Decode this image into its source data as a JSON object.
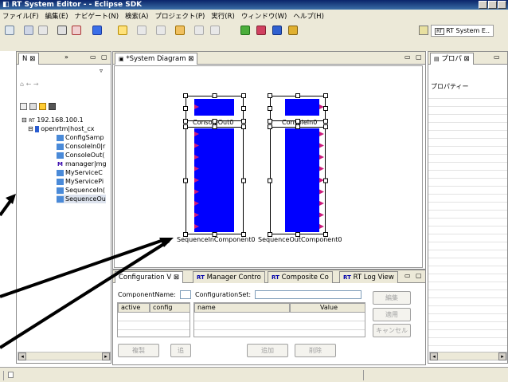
{
  "window": {
    "title": "RT System Editor - - Eclipse SDK"
  },
  "menu": [
    "ファイル(F)",
    "編集(E)",
    "ナビゲート(N)",
    "検索(A)",
    "プロジェクト(P)",
    "実行(R)",
    "ウィンドウ(W)",
    "ヘルプ(H)"
  ],
  "toolbar": {
    "perspective_label": "RT System E.."
  },
  "navigator": {
    "tab_label": "N",
    "nav_arrows": [
      "←",
      "→"
    ],
    "tree": [
      {
        "label": "192.168.100.1",
        "prefix": "RT",
        "level": 0
      },
      {
        "label": "openrtm|host_cx",
        "level": 1
      },
      {
        "label": "ConfigSamp",
        "level": 2
      },
      {
        "label": "ConsoleIn0|r",
        "level": 2
      },
      {
        "label": "ConsoleOut(",
        "level": 2
      },
      {
        "label": "manager|mg",
        "level": 2,
        "icon": "M"
      },
      {
        "label": "MyServiceC",
        "level": 2
      },
      {
        "label": "MyServicePi",
        "level": 2
      },
      {
        "label": "SequenceIn(",
        "level": 2
      },
      {
        "label": "SequenceOu",
        "level": 2,
        "selected": true
      }
    ]
  },
  "editor": {
    "tab_label": "*System Diagram",
    "components": {
      "console_out": "ConsoleOut0",
      "console_in": "ConsoleIn0",
      "sequence_in": "SequenceInComponent0",
      "sequence_out": "SequenceOutComponent0"
    }
  },
  "bottom_panel": {
    "tabs": [
      "Configuration V",
      "Manager Contro",
      "Composite Co",
      "RT Log View"
    ],
    "tab_prefix": "RT",
    "component_name_label": "ComponentName:",
    "configuration_set_label": "ConfigurationSet:",
    "left_grid_headers": [
      "active",
      "config"
    ],
    "right_grid_headers": [
      "name",
      "Value"
    ],
    "buttons": {
      "edit": "編集",
      "apply": "適用",
      "cancel": "キャンセル",
      "copy": "複製",
      "add_left": "追",
      "add": "追加",
      "delete": "削除"
    }
  },
  "properties": {
    "tab_label": "プロパ",
    "header": "プロパティー"
  },
  "colors": {
    "component": "#0000ff",
    "port": "#cc1a7a",
    "title_bar": "#0a246a"
  }
}
